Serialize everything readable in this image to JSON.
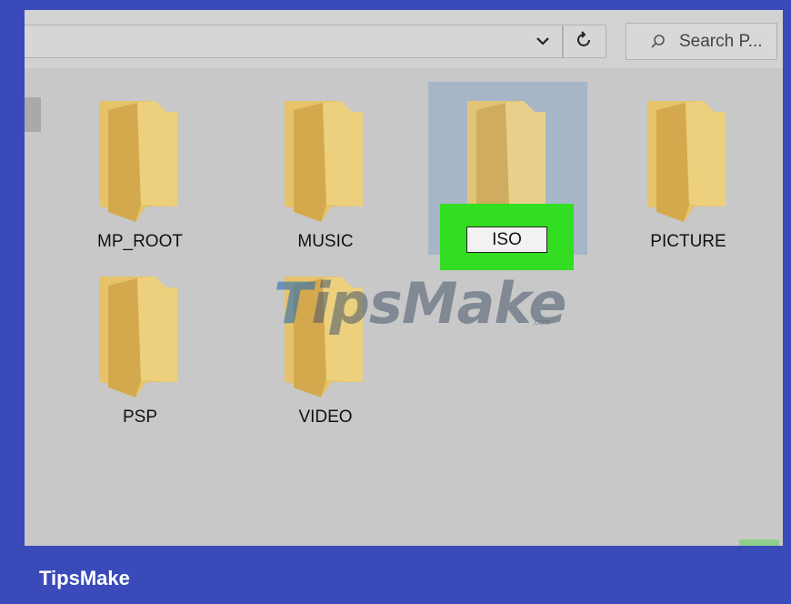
{
  "toolbar": {
    "dropdown_icon": "chevron-down-icon",
    "refresh_icon": "refresh-icon",
    "search": {
      "icon": "search-icon",
      "placeholder": "Search P..."
    }
  },
  "folders": [
    {
      "label": "MP_ROOT"
    },
    {
      "label": "MUSIC"
    },
    {
      "label": "ISO",
      "state": "renaming",
      "selected": true
    },
    {
      "label": "PICTURE"
    },
    {
      "label": "PSP"
    },
    {
      "label": "VIDEO"
    }
  ],
  "rename": {
    "value": "ISO"
  },
  "watermark": {
    "text_first": "T",
    "text_rest": "ipsMake",
    "suffix": ".com"
  },
  "brand": {
    "label": "TipsMake"
  },
  "colors": {
    "background_frame": "#3a4bb9",
    "folder": "#e8c56b",
    "selection": "#a6b6c7",
    "highlight": "#33dd22"
  }
}
